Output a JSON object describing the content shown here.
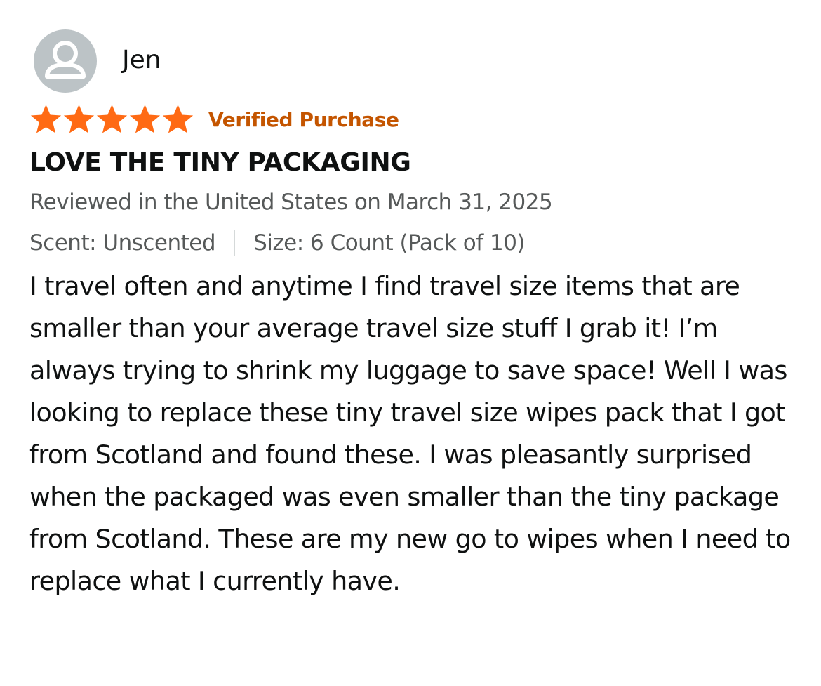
{
  "review": {
    "author": "Jen",
    "rating": 5,
    "rating_max": 5,
    "verified_label": "Verified Purchase",
    "title": "LOVE THE TINY PACKAGING",
    "date_line": "Reviewed in the United States on March 31, 2025",
    "scent": "Scent: Unscented",
    "size": "Size: 6 Count (Pack of 10)",
    "body": "I travel often and anytime I find travel size items that are smaller than your average travel size stuff I grab it! I’m always trying to shrink my luggage to save space! Well I was looking to replace these tiny travel size wipes pack that I got from Scotland and found these. I was pleasantly surprised when the packaged was even smaller than the tiny package from Scotland. These are my new go to wipes when I need to replace what I currently have."
  },
  "icons": {
    "avatar": "user-silhouette-icon",
    "star": "star-filled-icon"
  },
  "colors": {
    "star": "#ff6a14",
    "verified": "#c45500",
    "avatar_bg": "#bcc3c6",
    "secondary_text": "#565959",
    "primary_text": "#0f1111"
  }
}
